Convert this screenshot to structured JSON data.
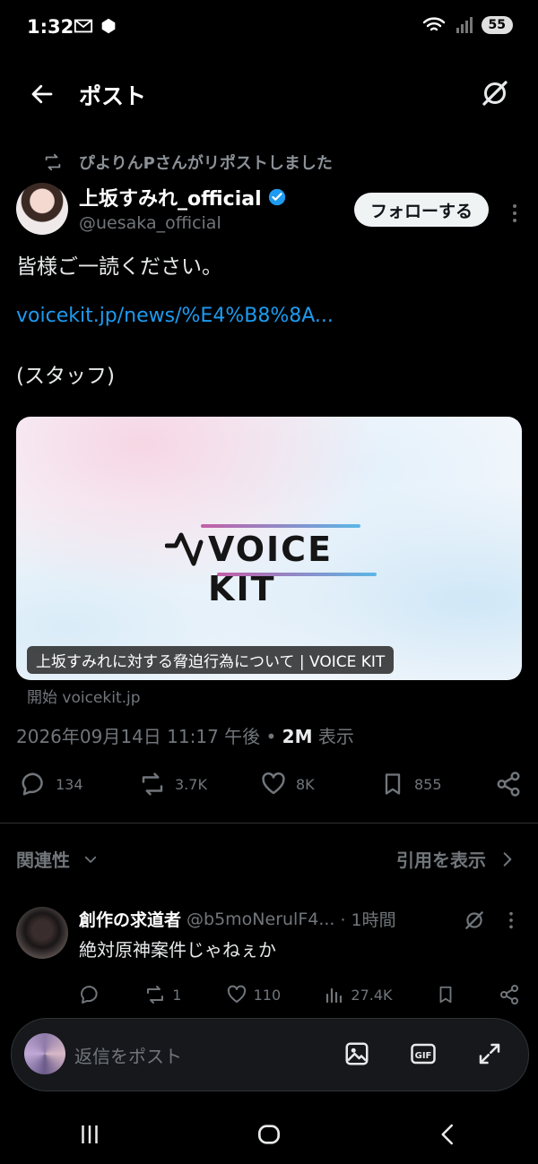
{
  "status": {
    "time": "1:32",
    "battery": "55",
    "icons": [
      "gmail-icon",
      "app-notification-icon",
      "wifi-icon",
      "signal-icon"
    ]
  },
  "header": {
    "title": "ポスト",
    "icons": [
      "back-arrow-icon",
      "grok-icon"
    ]
  },
  "repost": {
    "text": "ぴよりんPさんがリポストしました"
  },
  "author": {
    "name": "上坂すみれ_official",
    "handle": "@uesaka_official",
    "verified": true,
    "follow_label": "フォローする"
  },
  "post": {
    "line1": "皆様ご一読ください。",
    "link": "voicekit.jp/news/%E4%B8%8A...",
    "line3": "(スタッフ)"
  },
  "card": {
    "logo_text": "VOICE KIT",
    "caption": "上坂すみれに対する脅迫行為について | VOICE KIT",
    "source": "開始 voicekit.jp"
  },
  "meta": {
    "timestamp": "2026年09月14日 11:17 午後 •",
    "views": "2M",
    "views_label": "表示"
  },
  "actions": {
    "replies": "134",
    "reposts": "3.7K",
    "likes": "8K",
    "bookmarks": "855"
  },
  "sort": {
    "label": "関連性",
    "quotes_label": "引用を表示"
  },
  "reply": {
    "name": "創作の求道者",
    "handle": "@b5moNerulF4...",
    "time": "· 1時間",
    "text": "絶対原神案件じゃねぇか",
    "reposts": "1",
    "likes": "110",
    "views": "27.4K"
  },
  "compose": {
    "placeholder": "返信をポスト"
  },
  "colors": {
    "accent": "#1d9bf0",
    "background": "#000000",
    "muted": "#71767b"
  }
}
